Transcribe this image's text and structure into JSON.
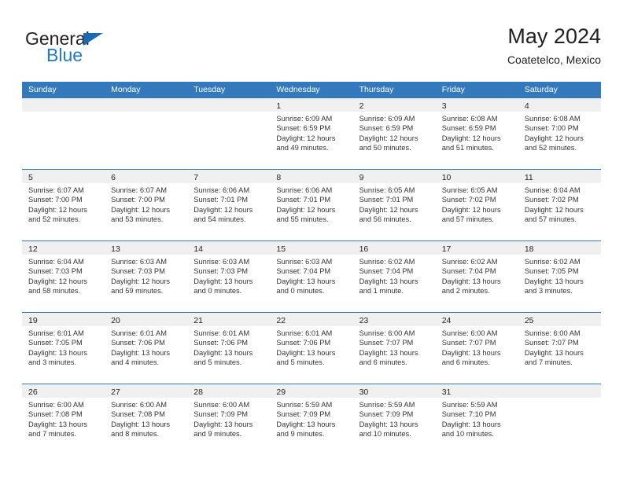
{
  "brand": {
    "name_top": "General",
    "name_bottom": "Blue",
    "accent_color": "#1b69b3",
    "blue_text_color": "#1f7ac0"
  },
  "header": {
    "title": "May 2024",
    "subtitle": "Coatetelco, Mexico"
  },
  "theme": {
    "header_row_bg": "#3479bb",
    "day_band_bg": "#f0f0f0",
    "text_color": "#231f20",
    "page_bg": "#ffffff"
  },
  "weekdays": [
    "Sunday",
    "Monday",
    "Tuesday",
    "Wednesday",
    "Thursday",
    "Friday",
    "Saturday"
  ],
  "weeks": [
    {
      "days": [
        {
          "number": "",
          "empty": true,
          "sunrise": "",
          "sunset": "",
          "daylight_line1": "",
          "daylight_line2": ""
        },
        {
          "number": "",
          "empty": true,
          "sunrise": "",
          "sunset": "",
          "daylight_line1": "",
          "daylight_line2": ""
        },
        {
          "number": "",
          "empty": true,
          "sunrise": "",
          "sunset": "",
          "daylight_line1": "",
          "daylight_line2": ""
        },
        {
          "number": "1",
          "empty": false,
          "sunrise": "Sunrise: 6:09 AM",
          "sunset": "Sunset: 6:59 PM",
          "daylight_line1": "Daylight: 12 hours",
          "daylight_line2": "and 49 minutes."
        },
        {
          "number": "2",
          "empty": false,
          "sunrise": "Sunrise: 6:09 AM",
          "sunset": "Sunset: 6:59 PM",
          "daylight_line1": "Daylight: 12 hours",
          "daylight_line2": "and 50 minutes."
        },
        {
          "number": "3",
          "empty": false,
          "sunrise": "Sunrise: 6:08 AM",
          "sunset": "Sunset: 6:59 PM",
          "daylight_line1": "Daylight: 12 hours",
          "daylight_line2": "and 51 minutes."
        },
        {
          "number": "4",
          "empty": false,
          "sunrise": "Sunrise: 6:08 AM",
          "sunset": "Sunset: 7:00 PM",
          "daylight_line1": "Daylight: 12 hours",
          "daylight_line2": "and 52 minutes."
        }
      ]
    },
    {
      "days": [
        {
          "number": "5",
          "empty": false,
          "sunrise": "Sunrise: 6:07 AM",
          "sunset": "Sunset: 7:00 PM",
          "daylight_line1": "Daylight: 12 hours",
          "daylight_line2": "and 52 minutes."
        },
        {
          "number": "6",
          "empty": false,
          "sunrise": "Sunrise: 6:07 AM",
          "sunset": "Sunset: 7:00 PM",
          "daylight_line1": "Daylight: 12 hours",
          "daylight_line2": "and 53 minutes."
        },
        {
          "number": "7",
          "empty": false,
          "sunrise": "Sunrise: 6:06 AM",
          "sunset": "Sunset: 7:01 PM",
          "daylight_line1": "Daylight: 12 hours",
          "daylight_line2": "and 54 minutes."
        },
        {
          "number": "8",
          "empty": false,
          "sunrise": "Sunrise: 6:06 AM",
          "sunset": "Sunset: 7:01 PM",
          "daylight_line1": "Daylight: 12 hours",
          "daylight_line2": "and 55 minutes."
        },
        {
          "number": "9",
          "empty": false,
          "sunrise": "Sunrise: 6:05 AM",
          "sunset": "Sunset: 7:01 PM",
          "daylight_line1": "Daylight: 12 hours",
          "daylight_line2": "and 56 minutes."
        },
        {
          "number": "10",
          "empty": false,
          "sunrise": "Sunrise: 6:05 AM",
          "sunset": "Sunset: 7:02 PM",
          "daylight_line1": "Daylight: 12 hours",
          "daylight_line2": "and 57 minutes."
        },
        {
          "number": "11",
          "empty": false,
          "sunrise": "Sunrise: 6:04 AM",
          "sunset": "Sunset: 7:02 PM",
          "daylight_line1": "Daylight: 12 hours",
          "daylight_line2": "and 57 minutes."
        }
      ]
    },
    {
      "days": [
        {
          "number": "12",
          "empty": false,
          "sunrise": "Sunrise: 6:04 AM",
          "sunset": "Sunset: 7:03 PM",
          "daylight_line1": "Daylight: 12 hours",
          "daylight_line2": "and 58 minutes."
        },
        {
          "number": "13",
          "empty": false,
          "sunrise": "Sunrise: 6:03 AM",
          "sunset": "Sunset: 7:03 PM",
          "daylight_line1": "Daylight: 12 hours",
          "daylight_line2": "and 59 minutes."
        },
        {
          "number": "14",
          "empty": false,
          "sunrise": "Sunrise: 6:03 AM",
          "sunset": "Sunset: 7:03 PM",
          "daylight_line1": "Daylight: 13 hours",
          "daylight_line2": "and 0 minutes."
        },
        {
          "number": "15",
          "empty": false,
          "sunrise": "Sunrise: 6:03 AM",
          "sunset": "Sunset: 7:04 PM",
          "daylight_line1": "Daylight: 13 hours",
          "daylight_line2": "and 0 minutes."
        },
        {
          "number": "16",
          "empty": false,
          "sunrise": "Sunrise: 6:02 AM",
          "sunset": "Sunset: 7:04 PM",
          "daylight_line1": "Daylight: 13 hours",
          "daylight_line2": "and 1 minute."
        },
        {
          "number": "17",
          "empty": false,
          "sunrise": "Sunrise: 6:02 AM",
          "sunset": "Sunset: 7:04 PM",
          "daylight_line1": "Daylight: 13 hours",
          "daylight_line2": "and 2 minutes."
        },
        {
          "number": "18",
          "empty": false,
          "sunrise": "Sunrise: 6:02 AM",
          "sunset": "Sunset: 7:05 PM",
          "daylight_line1": "Daylight: 13 hours",
          "daylight_line2": "and 3 minutes."
        }
      ]
    },
    {
      "days": [
        {
          "number": "19",
          "empty": false,
          "sunrise": "Sunrise: 6:01 AM",
          "sunset": "Sunset: 7:05 PM",
          "daylight_line1": "Daylight: 13 hours",
          "daylight_line2": "and 3 minutes."
        },
        {
          "number": "20",
          "empty": false,
          "sunrise": "Sunrise: 6:01 AM",
          "sunset": "Sunset: 7:06 PM",
          "daylight_line1": "Daylight: 13 hours",
          "daylight_line2": "and 4 minutes."
        },
        {
          "number": "21",
          "empty": false,
          "sunrise": "Sunrise: 6:01 AM",
          "sunset": "Sunset: 7:06 PM",
          "daylight_line1": "Daylight: 13 hours",
          "daylight_line2": "and 5 minutes."
        },
        {
          "number": "22",
          "empty": false,
          "sunrise": "Sunrise: 6:01 AM",
          "sunset": "Sunset: 7:06 PM",
          "daylight_line1": "Daylight: 13 hours",
          "daylight_line2": "and 5 minutes."
        },
        {
          "number": "23",
          "empty": false,
          "sunrise": "Sunrise: 6:00 AM",
          "sunset": "Sunset: 7:07 PM",
          "daylight_line1": "Daylight: 13 hours",
          "daylight_line2": "and 6 minutes."
        },
        {
          "number": "24",
          "empty": false,
          "sunrise": "Sunrise: 6:00 AM",
          "sunset": "Sunset: 7:07 PM",
          "daylight_line1": "Daylight: 13 hours",
          "daylight_line2": "and 6 minutes."
        },
        {
          "number": "25",
          "empty": false,
          "sunrise": "Sunrise: 6:00 AM",
          "sunset": "Sunset: 7:07 PM",
          "daylight_line1": "Daylight: 13 hours",
          "daylight_line2": "and 7 minutes."
        }
      ]
    },
    {
      "days": [
        {
          "number": "26",
          "empty": false,
          "sunrise": "Sunrise: 6:00 AM",
          "sunset": "Sunset: 7:08 PM",
          "daylight_line1": "Daylight: 13 hours",
          "daylight_line2": "and 7 minutes."
        },
        {
          "number": "27",
          "empty": false,
          "sunrise": "Sunrise: 6:00 AM",
          "sunset": "Sunset: 7:08 PM",
          "daylight_line1": "Daylight: 13 hours",
          "daylight_line2": "and 8 minutes."
        },
        {
          "number": "28",
          "empty": false,
          "sunrise": "Sunrise: 6:00 AM",
          "sunset": "Sunset: 7:09 PM",
          "daylight_line1": "Daylight: 13 hours",
          "daylight_line2": "and 9 minutes."
        },
        {
          "number": "29",
          "empty": false,
          "sunrise": "Sunrise: 5:59 AM",
          "sunset": "Sunset: 7:09 PM",
          "daylight_line1": "Daylight: 13 hours",
          "daylight_line2": "and 9 minutes."
        },
        {
          "number": "30",
          "empty": false,
          "sunrise": "Sunrise: 5:59 AM",
          "sunset": "Sunset: 7:09 PM",
          "daylight_line1": "Daylight: 13 hours",
          "daylight_line2": "and 10 minutes."
        },
        {
          "number": "31",
          "empty": false,
          "sunrise": "Sunrise: 5:59 AM",
          "sunset": "Sunset: 7:10 PM",
          "daylight_line1": "Daylight: 13 hours",
          "daylight_line2": "and 10 minutes."
        },
        {
          "number": "",
          "empty": true,
          "sunrise": "",
          "sunset": "",
          "daylight_line1": "",
          "daylight_line2": ""
        }
      ]
    }
  ]
}
